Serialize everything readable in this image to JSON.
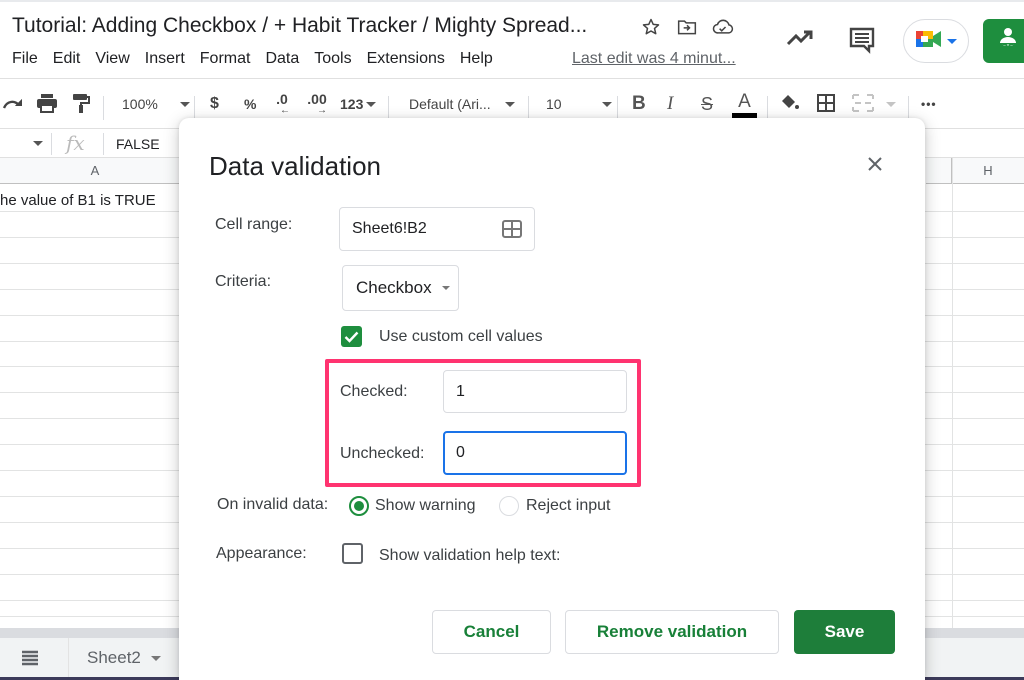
{
  "header": {
    "doc_title": "Tutorial: Adding Checkbox / + Habit Tracker / Mighty Spread...",
    "last_edit": "Last edit was 4 minut...",
    "menu": [
      "File",
      "Edit",
      "View",
      "Insert",
      "Format",
      "Data",
      "Tools",
      "Extensions",
      "Help"
    ]
  },
  "toolbar": {
    "zoom": "100%",
    "currency": "$",
    "percent": "%",
    "decrease_decimal": ".0",
    "increase_decimal": ".00",
    "number_format": "123",
    "font": "Default (Ari...",
    "font_size": "10",
    "bold": "B",
    "italic": "I",
    "strikethrough": "S",
    "text_color": "A",
    "more": "•••"
  },
  "formula_bar": {
    "fx": "fx",
    "value": "FALSE"
  },
  "grid": {
    "columns": [
      "A",
      "H"
    ],
    "cell_a1": "he value of B1 is TRUE"
  },
  "sheets": {
    "active_tab": "Sheet2"
  },
  "dialog": {
    "title": "Data validation",
    "cell_range_label": "Cell range:",
    "cell_range_value": "Sheet6!B2",
    "criteria_label": "Criteria:",
    "criteria_value": "Checkbox",
    "custom_values_label": "Use custom cell values",
    "custom_values_checked": true,
    "checked_label": "Checked:",
    "checked_value": "1",
    "unchecked_label": "Unchecked:",
    "unchecked_value": "0",
    "invalid_label": "On invalid data:",
    "invalid_options": [
      "Show warning",
      "Reject input"
    ],
    "invalid_selected": "Show warning",
    "appearance_label": "Appearance:",
    "help_text_label": "Show validation help text:",
    "help_text_checked": false,
    "buttons": {
      "cancel": "Cancel",
      "remove": "Remove validation",
      "save": "Save"
    }
  },
  "colors": {
    "accent_green": "#1e8e3e",
    "highlight_pink": "#ff3370",
    "focus_blue": "#1a73e8"
  }
}
